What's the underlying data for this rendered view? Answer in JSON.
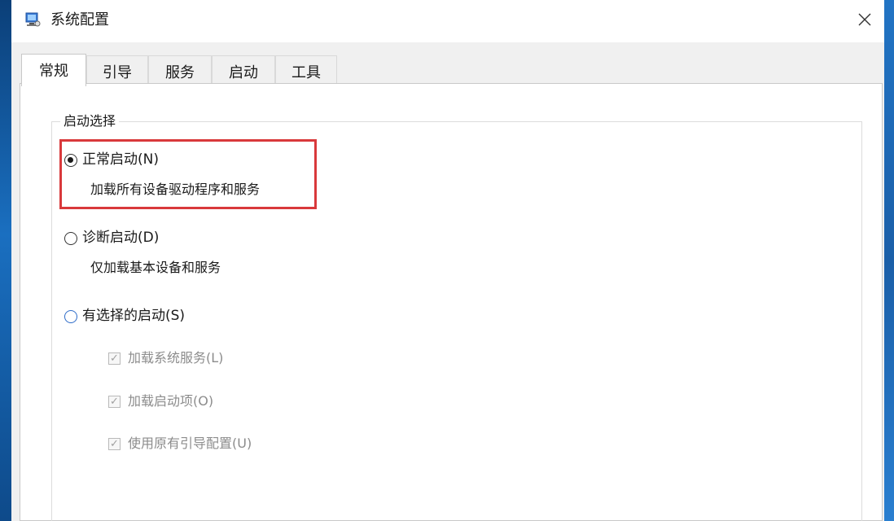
{
  "window": {
    "title": "系统配置",
    "icon": "msconfig-icon",
    "close_glyph": "✕"
  },
  "tabs": [
    {
      "label": "常规",
      "active": true
    },
    {
      "label": "引导",
      "active": false
    },
    {
      "label": "服务",
      "active": false
    },
    {
      "label": "启动",
      "active": false
    },
    {
      "label": "工具",
      "active": false
    }
  ],
  "startup_group": {
    "title": "启动选择",
    "options": [
      {
        "label": "正常启动(N)",
        "description": "加载所有设备驱动程序和服务",
        "selected": true
      },
      {
        "label": "诊断启动(D)",
        "description": "仅加载基本设备和服务",
        "selected": false
      },
      {
        "label": "有选择的启动(S)",
        "description": "",
        "selected": false
      }
    ],
    "selective_items": [
      {
        "label": "加载系统服务(L)",
        "checked": true,
        "enabled": false
      },
      {
        "label": "加载启动项(O)",
        "checked": true,
        "enabled": false
      },
      {
        "label": "使用原有引导配置(U)",
        "checked": true,
        "enabled": false
      }
    ]
  },
  "colors": {
    "highlight": "#d9393b",
    "desktop": "#1565a8",
    "radio_accent": "#2d6bc8"
  }
}
